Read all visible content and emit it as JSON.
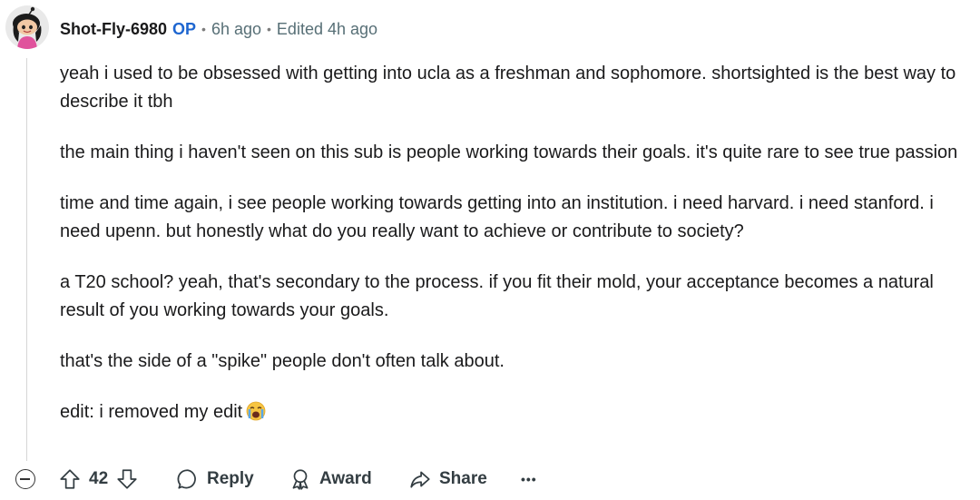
{
  "comment": {
    "author": "Shot-Fly-6980",
    "op_badge": "OP",
    "separator": "•",
    "time_posted": "6h ago",
    "edited": "Edited 4h ago",
    "paragraphs": [
      "yeah i used to be obsessed with getting into ucla as a freshman and sophomore. shortsighted is the best way to describe it tbh",
      "the main thing i haven't seen on this sub is people working towards their goals. it's quite rare to see true passion",
      "time and time again, i see people working towards getting into an institution. i need harvard. i need stanford. i need upenn. but honestly what do you really want to achieve or contribute to society?",
      "a T20 school? yeah, that's secondary to the process. if you fit their mold, your acceptance becomes a natural result of you working towards your goals.",
      "that's the side of a \"spike\" people don't often talk about.",
      "edit: i removed my edit"
    ],
    "final_emoji": "loudly-crying-face"
  },
  "actions": {
    "vote_count": "42",
    "reply_label": "Reply",
    "award_label": "Award",
    "share_label": "Share",
    "more_label": "•••"
  },
  "colors": {
    "op": "#1e66d0",
    "meta": "#576f76",
    "text": "#1a1a1b"
  }
}
